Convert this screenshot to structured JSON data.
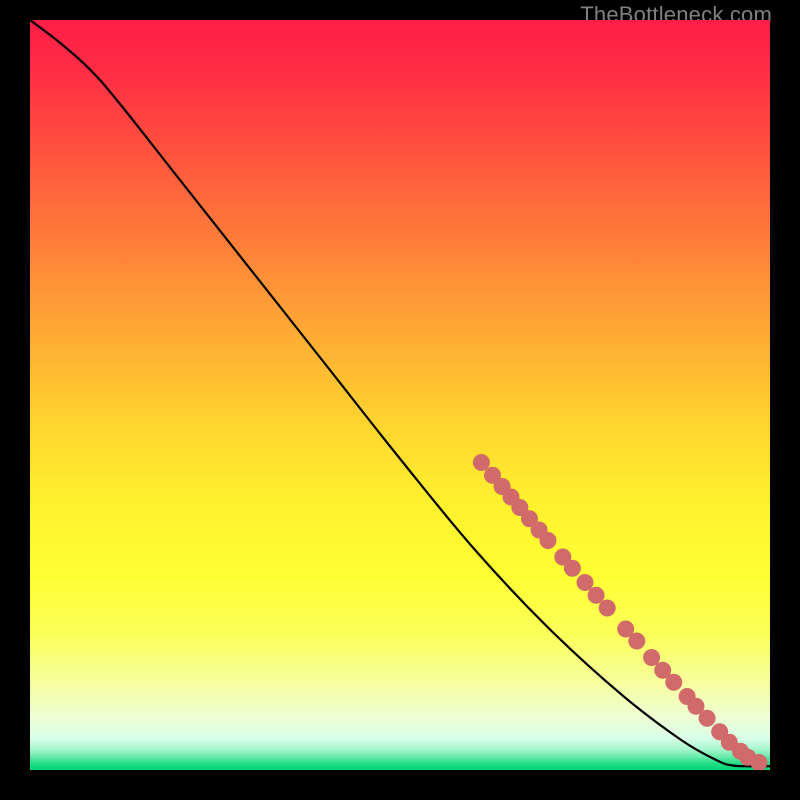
{
  "watermark": "TheBottleneck.com",
  "chart_data": {
    "type": "line",
    "title": "",
    "xlabel": "",
    "ylabel": "",
    "xlim": [
      0,
      100
    ],
    "ylim": [
      0,
      100
    ],
    "grid": false,
    "curve": [
      {
        "x": 0,
        "y": 100
      },
      {
        "x": 4,
        "y": 97
      },
      {
        "x": 8,
        "y": 93.5
      },
      {
        "x": 12,
        "y": 89
      },
      {
        "x": 20,
        "y": 79
      },
      {
        "x": 30,
        "y": 66.5
      },
      {
        "x": 40,
        "y": 54
      },
      {
        "x": 50,
        "y": 41.5
      },
      {
        "x": 60,
        "y": 29.5
      },
      {
        "x": 70,
        "y": 19
      },
      {
        "x": 80,
        "y": 10
      },
      {
        "x": 88,
        "y": 4
      },
      {
        "x": 93,
        "y": 1.2
      },
      {
        "x": 95,
        "y": 0.6
      },
      {
        "x": 97,
        "y": 0.5
      },
      {
        "x": 100,
        "y": 0.5
      }
    ],
    "points": [
      {
        "x": 61.0,
        "y": 41.0
      },
      {
        "x": 62.5,
        "y": 39.3
      },
      {
        "x": 63.8,
        "y": 37.8
      },
      {
        "x": 65.0,
        "y": 36.4
      },
      {
        "x": 66.2,
        "y": 35.0
      },
      {
        "x": 67.5,
        "y": 33.5
      },
      {
        "x": 68.8,
        "y": 32.0
      },
      {
        "x": 70.0,
        "y": 30.6
      },
      {
        "x": 72.0,
        "y": 28.4
      },
      {
        "x": 73.3,
        "y": 26.9
      },
      {
        "x": 75.0,
        "y": 25.0
      },
      {
        "x": 76.5,
        "y": 23.3
      },
      {
        "x": 78.0,
        "y": 21.6
      },
      {
        "x": 80.5,
        "y": 18.8
      },
      {
        "x": 82.0,
        "y": 17.2
      },
      {
        "x": 84.0,
        "y": 15.0
      },
      {
        "x": 85.5,
        "y": 13.3
      },
      {
        "x": 87.0,
        "y": 11.7
      },
      {
        "x": 88.8,
        "y": 9.8
      },
      {
        "x": 90.0,
        "y": 8.5
      },
      {
        "x": 91.5,
        "y": 6.9
      },
      {
        "x": 93.2,
        "y": 5.1
      },
      {
        "x": 94.5,
        "y": 3.7
      },
      {
        "x": 96.0,
        "y": 2.5
      },
      {
        "x": 97.0,
        "y": 1.7
      },
      {
        "x": 98.5,
        "y": 1.0
      }
    ],
    "gradient_stops": [
      {
        "offset": 0.0,
        "color": "#ff1e46"
      },
      {
        "offset": 0.06,
        "color": "#ff2b44"
      },
      {
        "offset": 0.14,
        "color": "#ff4540"
      },
      {
        "offset": 0.24,
        "color": "#ff6a3c"
      },
      {
        "offset": 0.34,
        "color": "#ff8e38"
      },
      {
        "offset": 0.44,
        "color": "#ffb233"
      },
      {
        "offset": 0.54,
        "color": "#ffd52f"
      },
      {
        "offset": 0.64,
        "color": "#fff02e"
      },
      {
        "offset": 0.74,
        "color": "#ffff33"
      },
      {
        "offset": 0.82,
        "color": "#fbff5a"
      },
      {
        "offset": 0.88,
        "color": "#f6ff9a"
      },
      {
        "offset": 0.93,
        "color": "#eeffd4"
      },
      {
        "offset": 0.958,
        "color": "#d9ffe8"
      },
      {
        "offset": 0.972,
        "color": "#a8f7cf"
      },
      {
        "offset": 0.983,
        "color": "#63e9a7"
      },
      {
        "offset": 0.992,
        "color": "#1fdc85"
      },
      {
        "offset": 1.0,
        "color": "#00d573"
      }
    ],
    "point_color": "#d16a6a",
    "curve_color": "#000000"
  }
}
